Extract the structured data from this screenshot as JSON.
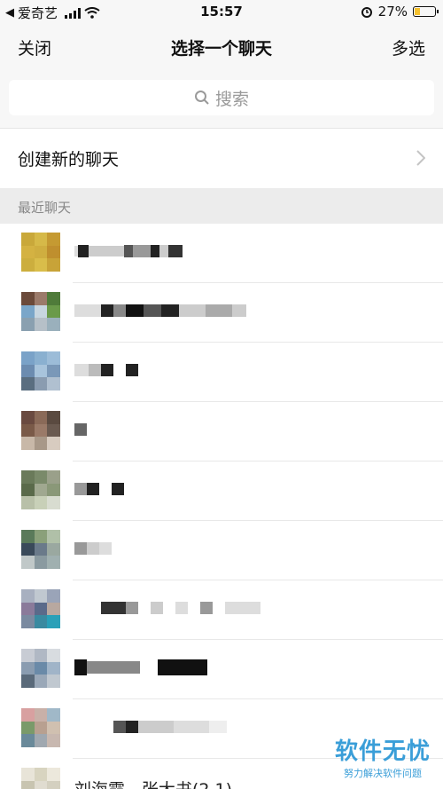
{
  "status_bar": {
    "carrier": "爱奇艺",
    "time": "15:57",
    "battery_percent": "27%",
    "battery_level": 0.27
  },
  "nav": {
    "close_label": "关闭",
    "title": "选择一个聊天",
    "multi_select_label": "多选"
  },
  "search": {
    "placeholder": "搜索"
  },
  "create_chat": {
    "label": "创建新的聊天"
  },
  "recent": {
    "section_label": "最近聊天",
    "visible_partial_text": "刘海霞 - 张大书(2.1)",
    "avatars": [
      [
        "#c9a83a",
        "#d6b948",
        "#c59a32",
        "#d4b242",
        "#cfae40",
        "#bf8f2e",
        "#ccae3e",
        "#d9bd4a",
        "#c8a338"
      ],
      [
        "#6b4a3a",
        "#9b7a6a",
        "#4f7b3a",
        "#7aa6c9",
        "#c8d6e0",
        "#6a9a4a",
        "#8aa0b0",
        "#b6c0c8",
        "#9ab0bc"
      ],
      [
        "#7aa2c8",
        "#8ab0d0",
        "#9cbcd8",
        "#6c8cb0",
        "#a8c4dc",
        "#7a98b8",
        "#5a6e80",
        "#8a9cb0",
        "#b0c0d0"
      ],
      [
        "#6a4a40",
        "#8a6a58",
        "#5a4a40",
        "#7a5a48",
        "#9a7a68",
        "#6a5a50",
        "#c8b8a8",
        "#a89888",
        "#d8ccc0"
      ],
      [
        "#6a7a5a",
        "#7a8a6a",
        "#9aa08a",
        "#5a6a4a",
        "#a0a890",
        "#8a9878",
        "#b8c0a8",
        "#c8d0b8",
        "#d8dcd0"
      ],
      [
        "#5a7a5a",
        "#8aa07a",
        "#b0c0a8",
        "#3a4a5a",
        "#6a7a8a",
        "#9aa8a0",
        "#c0c8c8",
        "#8a9aa0",
        "#a0b0b0"
      ],
      [
        "#a8b0c0",
        "#c0c8d0",
        "#9aa4b8",
        "#8a7a9a",
        "#5a6a8a",
        "#b8a8a0",
        "#7a8aa0",
        "#3a8aa0",
        "#2aa0b8"
      ],
      [
        "#c8ccd4",
        "#b0b8c4",
        "#d8dce0",
        "#8a9cb0",
        "#6a8aa8",
        "#a0b4c8",
        "#5a6a7a",
        "#9aa8b8",
        "#c0c8d0"
      ],
      [
        "#d8a0a0",
        "#c8b0a8",
        "#a0b8c8",
        "#7a9a6a",
        "#b8a090",
        "#d0c0b0",
        "#6a8a9a",
        "#a0a8b0",
        "#c8b8b0"
      ],
      [
        "#e8e4d8",
        "#d8d4c0",
        "#ece8dc",
        "#c8c4b0",
        "#e0dcd0",
        "#d4d0c0",
        "#f0ece0",
        "#e4e0d4",
        "#dcd8cc"
      ]
    ]
  },
  "watermark": {
    "main": "软件无忧",
    "sub": "努力解决软件问题"
  }
}
